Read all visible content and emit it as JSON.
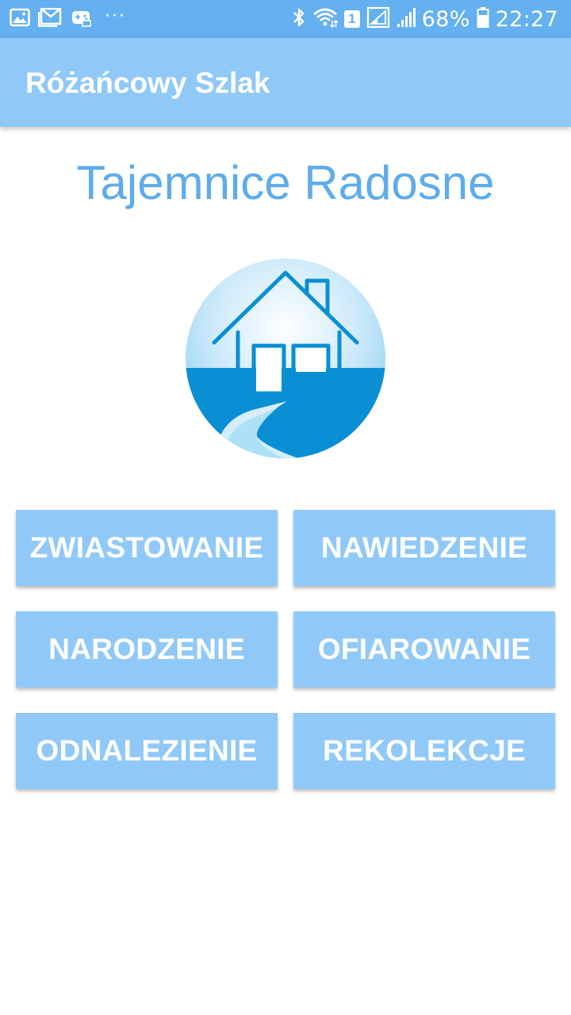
{
  "status_bar": {
    "left_icons": [
      "gallery-icon",
      "gmail-icon",
      "game-controller-icon"
    ],
    "more": "···",
    "right_icons": [
      "bluetooth-icon",
      "wifi-icon",
      "sim-badge",
      "signal-icon",
      "signal-icon",
      "battery-icon"
    ],
    "sim_number": "1",
    "battery_percent": "68%",
    "time": "22:27"
  },
  "app_bar": {
    "title": "Różańcowy Szlak"
  },
  "main": {
    "heading": "Tajemnice Radosne",
    "logo_icon": "house-road-icon",
    "buttons": [
      {
        "label": "ZWIASTOWANIE"
      },
      {
        "label": "NAWIEDZENIE"
      },
      {
        "label": "NARODZENIE"
      },
      {
        "label": "OFIAROWANIE"
      },
      {
        "label": "ODNALEZIENIE"
      },
      {
        "label": "REKOLEKCJE"
      }
    ]
  },
  "colors": {
    "status_bar": "#64b0f0",
    "app_bar": "#90c9f8",
    "heading": "#5eacec",
    "button": "#90c9f8",
    "logo_blue": "#0a8fd4"
  }
}
